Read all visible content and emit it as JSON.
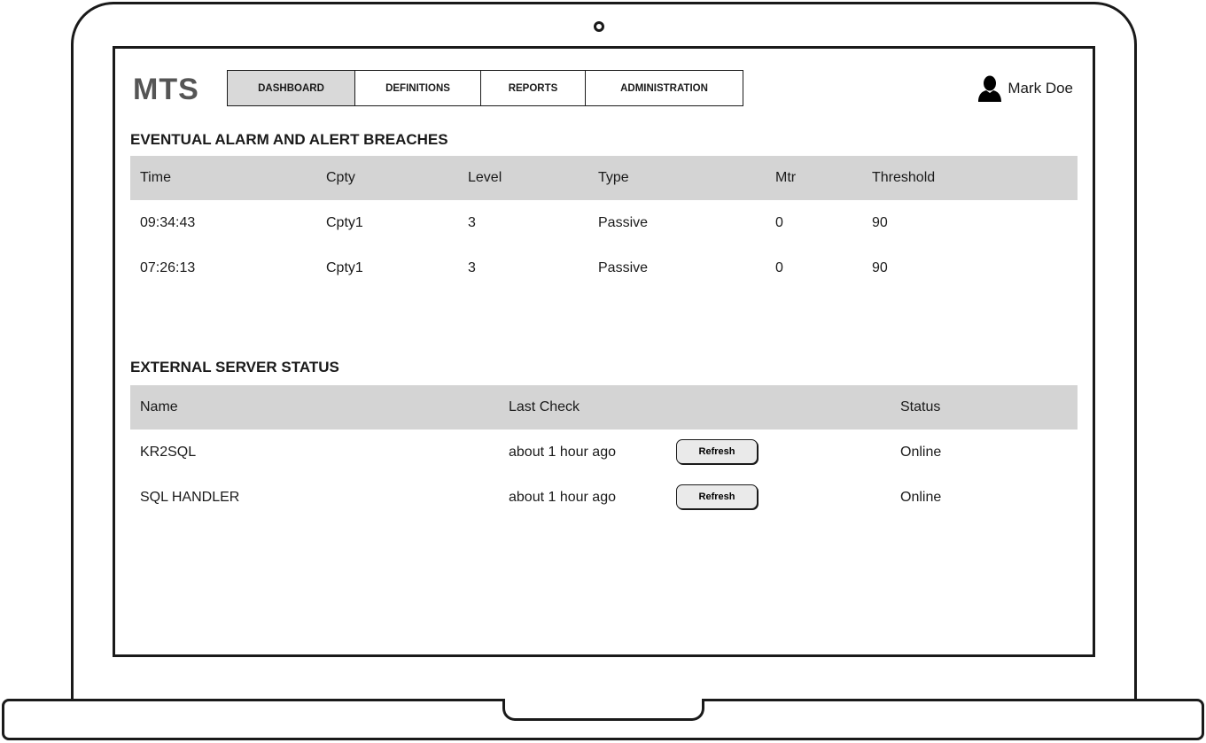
{
  "app": {
    "logo": "MTS"
  },
  "nav": {
    "tabs": [
      {
        "label": "DASHBOARD",
        "active": true
      },
      {
        "label": "DEFINITIONS",
        "active": false
      },
      {
        "label": "REPORTS",
        "active": false
      },
      {
        "label": "ADMINISTRATION",
        "active": false
      }
    ]
  },
  "user": {
    "name": "Mark Doe",
    "icon": "user-icon"
  },
  "alarms": {
    "title": "EVENTUAL ALARM AND ALERT BREACHES",
    "columns": [
      "Time",
      "Cpty",
      "Level",
      "Type",
      "Mtr",
      "Threshold"
    ],
    "rows": [
      [
        "09:34:43",
        "Cpty1",
        "3",
        "Passive",
        "0",
        "90"
      ],
      [
        "07:26:13",
        "Cpty1",
        "3",
        "Passive",
        "0",
        "90"
      ]
    ]
  },
  "servers": {
    "title": "EXTERNAL SERVER STATUS",
    "columns": [
      "Name",
      "Last Check",
      "Status"
    ],
    "refresh_label": "Refresh",
    "rows": [
      {
        "name": "KR2SQL",
        "last_check": "about 1 hour ago",
        "status": "Online"
      },
      {
        "name": "SQL HANDLER",
        "last_check": "about 1 hour ago",
        "status": "Online"
      }
    ]
  },
  "colors": {
    "header_bg": "#d4d4d4",
    "active_tab_bg": "#d9d9d9",
    "button_bg": "#eaeaea"
  }
}
